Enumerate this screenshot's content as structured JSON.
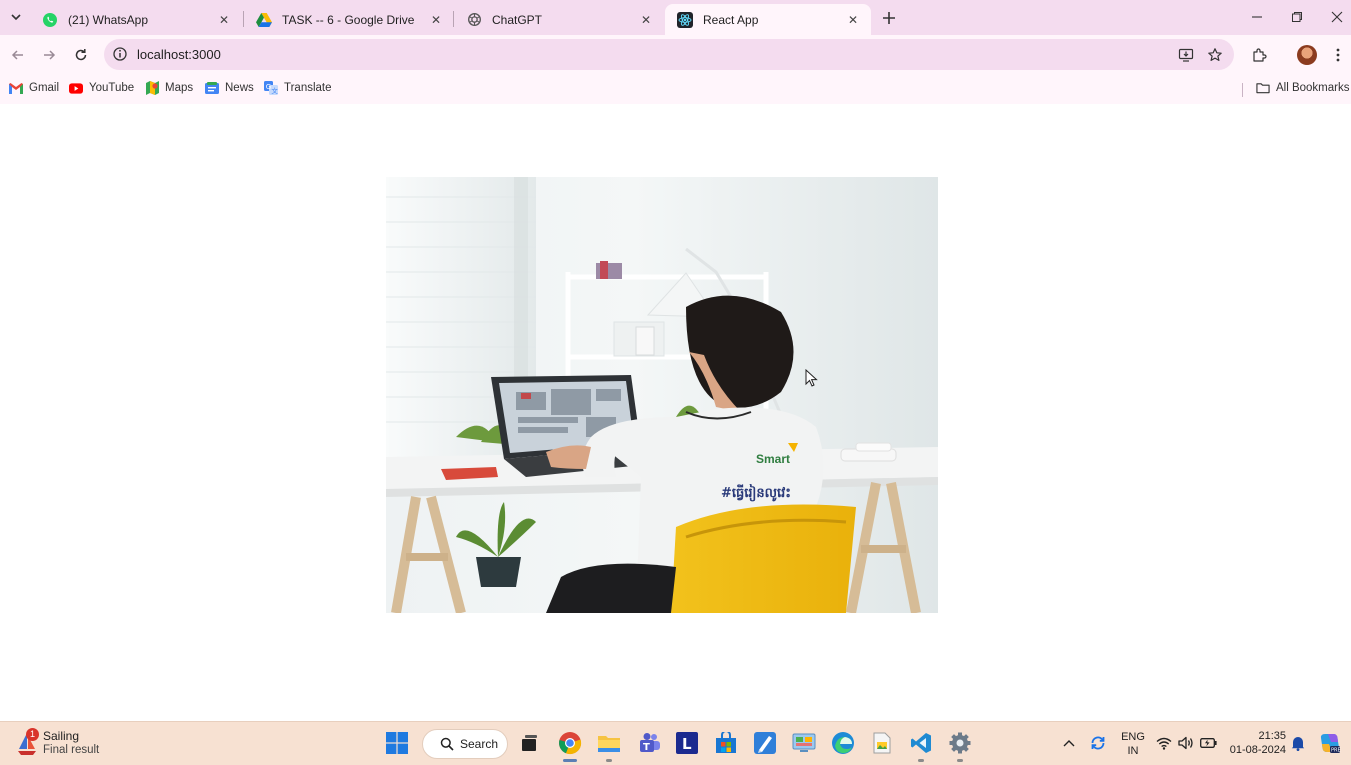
{
  "browser": {
    "tabs": [
      {
        "title": "(21) WhatsApp",
        "icon": "whatsapp-icon"
      },
      {
        "title": "TASK -- 6 - Google Drive",
        "icon": "google-drive-icon"
      },
      {
        "title": "ChatGPT",
        "icon": "chatgpt-icon"
      },
      {
        "title": "React App",
        "icon": "react-icon",
        "active": true
      }
    ],
    "address": "localhost:3000",
    "bookmarks": [
      {
        "label": "Gmail",
        "icon": "gmail-icon"
      },
      {
        "label": "YouTube",
        "icon": "youtube-icon"
      },
      {
        "label": "Maps",
        "icon": "maps-icon"
      },
      {
        "label": "News",
        "icon": "news-icon"
      },
      {
        "label": "Translate",
        "icon": "translate-icon"
      }
    ],
    "all_bookmarks": "All Bookmarks"
  },
  "page": {
    "image": {
      "subject": "person-at-laptop-desk",
      "shirt_logo": "Smart",
      "shirt_tagline": "#ធ្វើរៀនលូវេះ"
    }
  },
  "taskbar": {
    "weather": {
      "badge": "1",
      "title": "Sailing",
      "subtitle": "Final result"
    },
    "search_label": "Search",
    "language": {
      "line1": "ENG",
      "line2": "IN"
    },
    "clock": {
      "time": "21:35",
      "date": "01-08-2024"
    },
    "accent": "#5b7fb5"
  }
}
